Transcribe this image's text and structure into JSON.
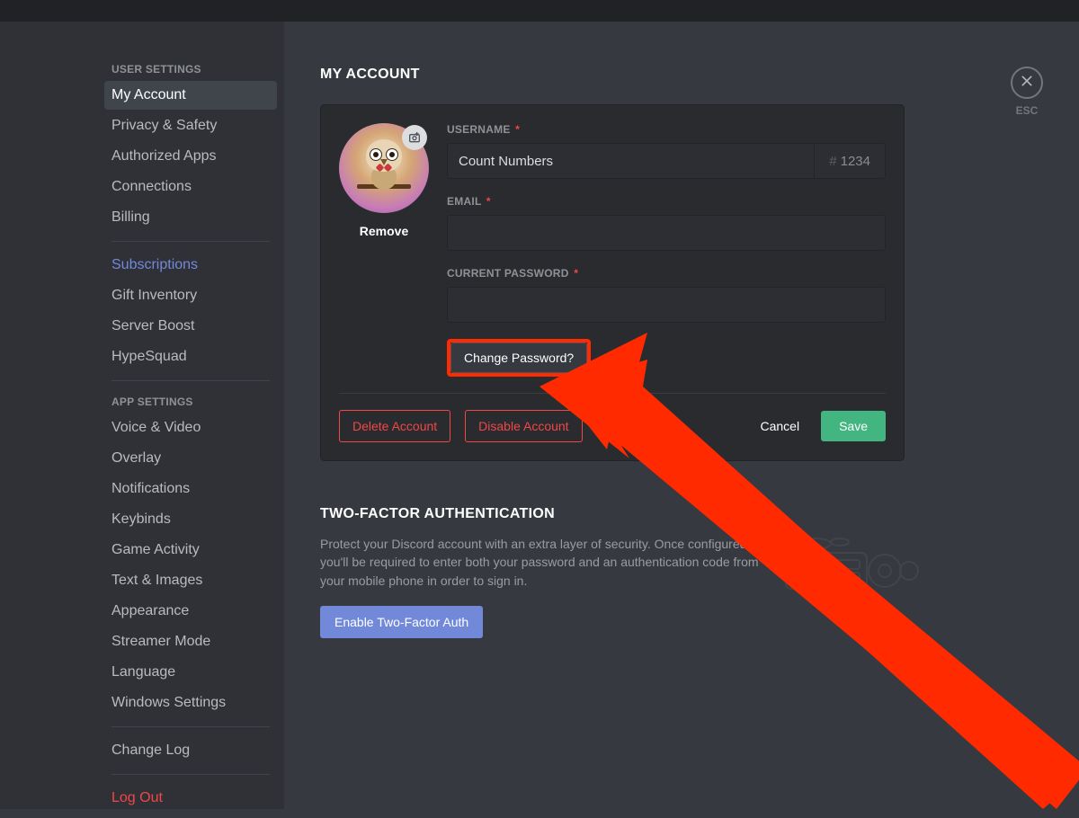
{
  "sidebar": {
    "sections": {
      "user_header": "USER SETTINGS",
      "app_header": "APP SETTINGS"
    },
    "user_items": [
      {
        "label": "My Account",
        "selected": true
      },
      {
        "label": "Privacy & Safety"
      },
      {
        "label": "Authorized Apps"
      },
      {
        "label": "Connections"
      },
      {
        "label": "Billing"
      }
    ],
    "nitro_items": [
      {
        "label": "Subscriptions",
        "accent": true
      },
      {
        "label": "Gift Inventory"
      },
      {
        "label": "Server Boost"
      },
      {
        "label": "HypeSquad"
      }
    ],
    "app_items": [
      {
        "label": "Voice & Video"
      },
      {
        "label": "Overlay"
      },
      {
        "label": "Notifications"
      },
      {
        "label": "Keybinds"
      },
      {
        "label": "Game Activity"
      },
      {
        "label": "Text & Images"
      },
      {
        "label": "Appearance"
      },
      {
        "label": "Streamer Mode"
      },
      {
        "label": "Language"
      },
      {
        "label": "Windows Settings"
      }
    ],
    "bottom_items": [
      {
        "label": "Change Log"
      },
      {
        "label": "Log Out",
        "danger": true
      }
    ]
  },
  "page": {
    "title": "MY ACCOUNT"
  },
  "account": {
    "username_label": "USERNAME",
    "username_value": "Count Numbers",
    "discriminator_hash": "#",
    "discriminator_value": "1234",
    "email_label": "EMAIL",
    "password_label": "CURRENT PASSWORD",
    "remove_label": "Remove",
    "change_password_label": "Change Password?",
    "delete_label": "Delete Account",
    "disable_label": "Disable Account",
    "cancel_label": "Cancel",
    "save_label": "Save"
  },
  "twofa": {
    "title": "TWO-FACTOR AUTHENTICATION",
    "description": "Protect your Discord account with an extra layer of security. Once configured you'll be required to enter both your password and an authentication code from your mobile phone in order to sign in.",
    "enable_label": "Enable Two-Factor Auth"
  },
  "close": {
    "esc_label": "ESC"
  }
}
